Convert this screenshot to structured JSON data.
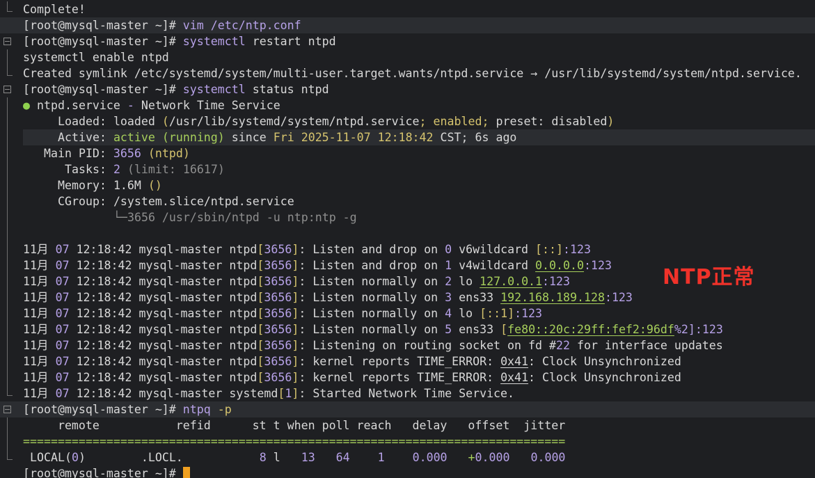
{
  "terminal": {
    "line_complete": "Complete!",
    "prompt": "[root@mysql-master ~]#",
    "cmd1": "vim /etc/ntp.conf",
    "cmd2_keyword": "systemctl",
    "cmd2_rest": "restart ntpd",
    "line_enable": "systemctl enable ntpd",
    "line_symlink": "Created symlink /etc/systemd/system/multi-user.target.wants/ntpd.service → /usr/lib/systemd/system/ntpd.service.",
    "cmd3_keyword": "systemctl",
    "cmd3_rest": "status ntpd",
    "status": {
      "bullet": "●",
      "unit": "ntpd.service",
      "dash": "-",
      "description": "Network Time Service",
      "loaded_label": "Loaded:",
      "loaded_value": "loaded",
      "loaded_paren_open": "(",
      "loaded_path": "/usr/lib/systemd/system/ntpd.service",
      "loaded_sep": ";",
      "loaded_enabled": "enabled",
      "loaded_sep2": ";",
      "loaded_preset_label": "preset:",
      "loaded_preset_value": "disabled",
      "loaded_paren_close": ")",
      "active_label": "Active:",
      "active_value": "active (running)",
      "active_since": "since",
      "active_date": "Fri 2025-11-07 12:18:42",
      "active_tz": "CST; 6s ago",
      "pid_label": "Main PID:",
      "pid_value": "3656",
      "pid_name": "(ntpd)",
      "tasks_label": "Tasks:",
      "tasks_value": "2",
      "tasks_limit": "(limit: 16617)",
      "memory_label": "Memory:",
      "memory_value": "1.6M",
      "memory_paren": "()",
      "cgroup_label": "CGroup:",
      "cgroup_value": "/system.slice/ntpd.service",
      "cgroup_child": "└─3656 /usr/sbin/ntpd -u ntp:ntp -g"
    },
    "logs": [
      {
        "month": "11月",
        "day": "07",
        "time": "12:18:42",
        "host": "mysql-master",
        "proc": "ntpd",
        "pid": "3656",
        "pre": "Listen and drop on",
        "num": "0",
        "mid": "v6wildcard",
        "addr": "[::]",
        "addr_ul": "",
        "tail": ":123"
      },
      {
        "month": "11月",
        "day": "07",
        "time": "12:18:42",
        "host": "mysql-master",
        "proc": "ntpd",
        "pid": "3656",
        "pre": "Listen and drop on",
        "num": "1",
        "mid": "v4wildcard",
        "addr": "",
        "addr_ul": "0.0.0.0",
        "tail": ":123"
      },
      {
        "month": "11月",
        "day": "07",
        "time": "12:18:42",
        "host": "mysql-master",
        "proc": "ntpd",
        "pid": "3656",
        "pre": "Listen normally on",
        "num": "2",
        "mid": "lo",
        "addr": "",
        "addr_ul": "127.0.0.1",
        "tail": ":123"
      },
      {
        "month": "11月",
        "day": "07",
        "time": "12:18:42",
        "host": "mysql-master",
        "proc": "ntpd",
        "pid": "3656",
        "pre": "Listen normally on",
        "num": "3",
        "mid": "ens33",
        "addr": "",
        "addr_ul": "192.168.189.128",
        "tail": ":123"
      },
      {
        "month": "11月",
        "day": "07",
        "time": "12:18:42",
        "host": "mysql-master",
        "proc": "ntpd",
        "pid": "3656",
        "pre": "Listen normally on",
        "num": "4",
        "mid": "lo",
        "addr": "[::1]",
        "addr_ul": "",
        "tail": ":123"
      },
      {
        "month": "11月",
        "day": "07",
        "time": "12:18:42",
        "host": "mysql-master",
        "proc": "ntpd",
        "pid": "3656",
        "pre": "Listen normally on",
        "num": "5",
        "mid": "ens33",
        "addr": "[",
        "addr_ul": "fe80::20c:29ff:fef2:96df",
        "tail": "%2]:123"
      }
    ],
    "log_route": {
      "month": "11月",
      "day": "07",
      "time": "12:18:42",
      "host": "mysql-master",
      "proc": "ntpd",
      "pid": "3656",
      "pre": "Listening on routing socket on fd #",
      "num": "22",
      "post": "for interface updates"
    },
    "log_kernel": [
      {
        "month": "11月",
        "day": "07",
        "time": "12:18:42",
        "host": "mysql-master",
        "proc": "ntpd",
        "pid": "3656",
        "pre": "kernel reports TIME_ERROR:",
        "code": "0x41",
        "post": ": Clock Unsynchronized"
      },
      {
        "month": "11月",
        "day": "07",
        "time": "12:18:42",
        "host": "mysql-master",
        "proc": "ntpd",
        "pid": "3656",
        "pre": "kernel reports TIME_ERROR:",
        "code": "0x41",
        "post": ": Clock Unsynchronized"
      }
    ],
    "log_systemd": {
      "month": "11月",
      "day": "07",
      "time": "12:18:42",
      "host": "mysql-master",
      "proc": "systemd",
      "pid": "1",
      "msg": "Started Network Time Service."
    },
    "cmd4_keyword": "ntpq",
    "cmd4_flag": "-p",
    "ntpq_header": "     remote           refid      st t when poll reach   delay   offset  jitter",
    "ntpq_rule": "==============================================================================",
    "ntpq_row": {
      "remote_a": " LOCAL(",
      "remote_num": "0",
      "remote_b": ")",
      "refid": "        .LOCL.",
      "st": "8",
      "t": "l",
      "when": "13",
      "poll": "64",
      "reach": "1",
      "delay": "0.000",
      "offset_sign": "+",
      "offset": "0.000",
      "jitter": "0.000"
    }
  },
  "annotation": "NTP正常",
  "colors": {
    "background": "#1e1f22",
    "text": "#d8d8d8",
    "purple": "#b7a2e8",
    "yellow": "#d6c46e",
    "green": "#a7cf5b",
    "annotation_red": "#f0322a",
    "cursor": "#f0a020"
  }
}
